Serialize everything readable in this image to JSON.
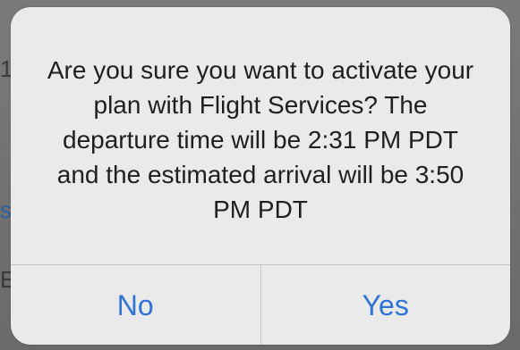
{
  "alert": {
    "message": "Are you sure you want to activate your plan with Flight Services? The departure time will be 2:31 PM PDT and the estimated arrival will be 3:50 PM PDT",
    "buttons": {
      "no_label": "No",
      "yes_label": "Yes"
    }
  },
  "colors": {
    "button_text": "#2f72d8",
    "alert_background": "#eaeaea",
    "dim_background": "#6f6f6f"
  }
}
